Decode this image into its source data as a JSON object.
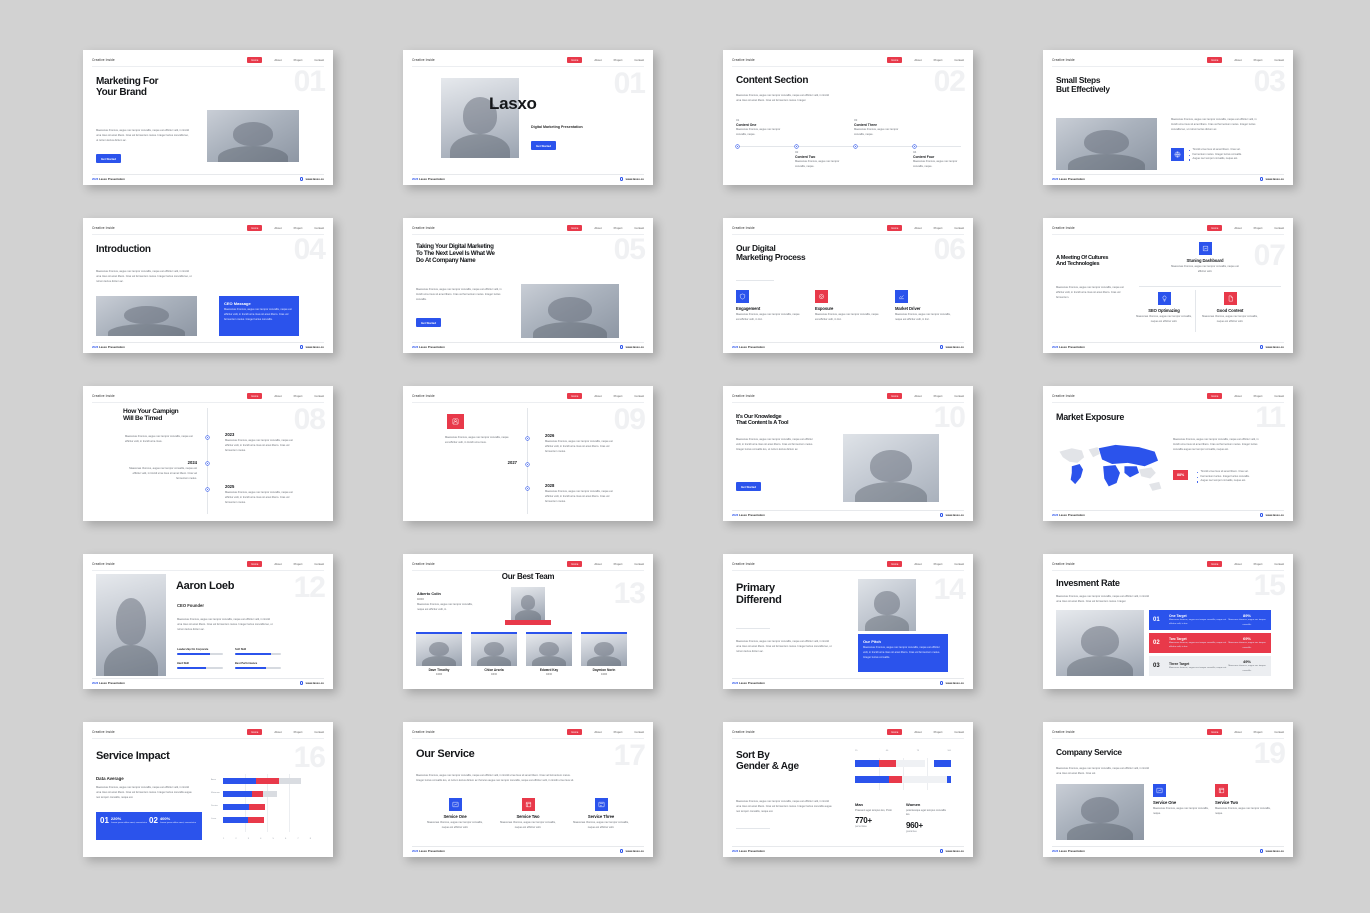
{
  "meta": {
    "brand": "Creative Inside",
    "nav": [
      "Home",
      "About",
      "Project",
      "Contact"
    ],
    "footer_left_year": "2023",
    "footer_left_text": " Lasxo Presentation",
    "footer_right": "www.lasxo.co",
    "accent_blue": "#2b53ec",
    "accent_red": "#e8394a",
    "number_grey": "#f0f1f3",
    "lorem_short": "Maecenas rhoncus, augue nec tempor convallis, neque est efficitur velit.",
    "lorem_mid": "Maecenas rhoncus, augue nec tempor convallis, neque est efficitur velit, in tincidi urna risus sit amet libero. Cras vel fermentum metus. Integer luctus convallis leo, ut rutrum lectus dictum ac.",
    "lorem_tiny": "Maecenas rhoncus, augue nec tempor convallis, neque est efficitur velit, in tincid."
  },
  "slides": [
    {
      "number": "01",
      "title": "Marketing For\nYour Brand",
      "body": "Maecenas rhoncus, augue nec tempor convallis, neque est efficitur velit, in tincidi urna risus sit amet libero. Cras vel fermentum metus. Integer luctus convallis leo, ut rutrum lectus dictum ac.",
      "cta": "Get Started"
    },
    {
      "number": "01",
      "title": "Lasxo",
      "subtitle": "Digital Marketing Presentation",
      "cta": "Get Started"
    },
    {
      "number": "02",
      "title": "Content Section",
      "body": "Maecenas rhoncus, augue nec tempor convallis, neque est efficitur velit, in tincidi urna risus sit amet libero. Cras vel fermentum metus. Integer.",
      "items": [
        {
          "num": "01",
          "label": "Content One",
          "body": "Maecenas rhoncus, augue nec tempor convallis, neque."
        },
        {
          "num": "02",
          "label": "Content Two",
          "body": "Maecenas rhoncus, augue nec tempor convallis, neque."
        },
        {
          "num": "03",
          "label": "Content Three",
          "body": "Maecenas rhoncus, augue nec tempor convallis, neque."
        },
        {
          "num": "04",
          "label": "Content Four",
          "body": "Maecenas rhoncus, augue nec tempor convallis, neque."
        }
      ]
    },
    {
      "number": "03",
      "title": "Small Steps\nBut Effectively",
      "body": "Maecenas rhoncus, augue nec tempor convallis, neque est efficitur velit, in tincidi urna risus sit amet libero. Cras vel fermentum metus. Integer luctus convallis leo, ut rutrum lectus dictum ac.",
      "bullets": [
        "Tincidi urna risus sit amet libero. Cras vel.",
        "Fermentum metus. Integer luctus convallis.",
        "Augue nec tempor convallis, neque est."
      ],
      "icon": "globe-icon"
    },
    {
      "number": "04",
      "title": "Introduction",
      "body": "Maecenas rhoncus, augue nec tempor convallis, neque est efficitur velit, in tincidi urna risus sit amet libero. Cras vel fermentum metus. Integer luctus convallis leo, ut rutrum lectus dictum ac.",
      "card_title": "CEO Massage",
      "card_body": "Maecenas rhoncus, augue nec tempor convallis, neque est efficitur velit, in tincidi urna risus sit amet libero. Cras vel fermentum metus. Integer luctus convallis."
    },
    {
      "number": "05",
      "title": "Taking Your Digital Marketing\nTo The Next Level Is What We\nDo At Company Name",
      "body": "Maecenas rhoncus, augue nec tempor convallis, neque est efficitur velit, in tincidi urna risus sit amet libero. Cras vel fermentum metus. Integer luctus convallis.",
      "cta": "Get Started"
    },
    {
      "number": "06",
      "title": "Our Digital\nMarketing Process",
      "features": [
        {
          "label": "Engagement",
          "body": "Maecenas rhoncus, augue nec tempor convallis, neque est efficitur velit, in tinc.",
          "color": "blue",
          "icon": "shield-icon"
        },
        {
          "label": "Exposure",
          "body": "Maecenas rhoncus, augue nec tempor convallis, neque est efficitur velit, in tinc.",
          "color": "red",
          "icon": "target-icon"
        },
        {
          "label": "Market Driver",
          "body": "Maecenas rhoncus, augue nec tempor convallis, neque est efficitur velit, in tinc.",
          "color": "blue",
          "icon": "chart-icon"
        }
      ]
    },
    {
      "number": "07",
      "title": "A Meeting Of Cultures\nAnd Technologies",
      "body": "Maecenas rhoncus, augue nec tempor convallis, neque est efficitur velit, in tincidi urna risus sit amet libero. Cras vel fermentum.",
      "features": [
        {
          "label": "Stuning Dashboard",
          "body": "Maecenas rhoncus, augue nec tempor convallis, neque est efficitur velit.",
          "color": "blue",
          "icon": "dashboard-icon"
        },
        {
          "label": "SEO Optimazing",
          "body": "Maecenas rhoncus, augue nec tempor convallis, neque est efficitur velit.",
          "color": "blue",
          "icon": "bulb-icon"
        },
        {
          "label": "Good Content",
          "body": "Maecenas rhoncus, augue nec tempor convallis, neque est efficitur velit.",
          "color": "red",
          "icon": "doc-icon"
        }
      ]
    },
    {
      "number": "08",
      "title": "How Your Campign\nWill Be Timed",
      "events": [
        {
          "year": "2023",
          "body": "Maecenas rhoncus, augue nec tempor convallis, neque est efficitur velit, in tincidi urna risus sit amet libero. Cras vel fermentum metus.",
          "side": "right"
        },
        {
          "year": "2024",
          "body": "Maecenas rhoncus, augue nec tempor convallis, neque est efficitur velit, in tincidi urna risus sit amet libero. Cras vel fermentum metus.",
          "side": "left"
        },
        {
          "year": "2025",
          "body": "Maecenas rhoncus, augue nec tempor convallis, neque est efficitur velit, in tincidi urna risus sit amet libero. Cras vel fermentum metus.",
          "side": "right"
        }
      ],
      "lead": "Maecenas rhoncus, augue nec tempor convallis, neque est efficitur velit, in tincidi urna risus."
    },
    {
      "number": "09",
      "title": "",
      "icon": "user-icon",
      "lead": "Maecenas rhoncus, augue nec tempor convallis, neque est efficitur velit, in tincidi urna risus.",
      "events": [
        {
          "year": "2026",
          "body": "Maecenas rhoncus, augue nec tempor convallis, neque est efficitur velit, in tincidi urna risus sit amet libero. Cras vel fermentum metus.",
          "side": "right"
        },
        {
          "year": "2027",
          "body": "",
          "side": "left"
        },
        {
          "year": "2028",
          "body": "Maecenas rhoncus, augue nec tempor convallis, neque est efficitur velit, in tincidi urna risus sit amet libero. Cras vel fermentum metus.",
          "side": "right"
        }
      ]
    },
    {
      "number": "10",
      "title": "It's Our Knowledge\nThat Content Is A Tool",
      "body": "Maecenas rhoncus, augue nec tempor convallis, neque est efficitur velit, in tincidi urna risus sit amet libero. Cras vel fermentum metus. Integer luctus convallis leo, ut rutrum lectus dictum ac.",
      "cta": "Get Started"
    },
    {
      "number": "11",
      "title": "Market Exposure",
      "body": "Maecenas rhoncus, augue nec tempor convallis, neque est efficitur velit, in tincidi urna risus sit amet libero. Cras vel fermentum metus. Integer luctus convallis augue nec tempor convallis, neque est.",
      "badge": "88%",
      "bullets": [
        "Tincidi urna risus sit amet libero. Cras vel.",
        "Fermentum luctus. Integer luctus convallis.",
        "Augue nec tempor convallis, neque est."
      ]
    },
    {
      "number": "12",
      "name": "Aaron Loeb",
      "role": "CEO Founder",
      "body": "Maecenas rhoncus, augue nec tempor convallis, neque est efficitur velit, in tincidi urna risus sit amet libero. Cras vel fermentum metus. Integer luctus convallis leo, ut rutrum lectus dictum ac.",
      "skills": [
        {
          "label": "Leadership On Corporate",
          "value": 72
        },
        {
          "label": "Soft Skill",
          "value": 78
        },
        {
          "label": "Hard Skill",
          "value": 62
        },
        {
          "label": "Best Performance",
          "value": 68
        }
      ]
    },
    {
      "number": "13",
      "title": "Our Best Team",
      "lead_name": "Alberto Colin",
      "lead_role": "COO",
      "lead_body": "Maecenas rhoncus, augue nec tempor convallis, neque est efficitur velit, in.",
      "members": [
        {
          "name": "Dave Timothy",
          "role": "COO"
        },
        {
          "name": "Chloe Arsela",
          "role": "CFO"
        },
        {
          "name": "Edward Kay",
          "role": "CFO"
        },
        {
          "name": "Daymion Norin",
          "role": "COO"
        }
      ]
    },
    {
      "number": "14",
      "title": "Primary\nDifferend",
      "body": "Maecenas rhoncus, augue nec tempor convallis, neque est efficitur velit, in tincidi urna risus sit amet libero. Cras vel fermentum metus. Integer luctus convallis leo, ut rutrum lectus dictum ac.",
      "card_title": "Our Pitch",
      "card_body": "Maecenas rhoncus, augue nec tempor convallis, neque est efficitur velit, in tincidi urna risus sit amet libero. Cras vel fermentum metus. Integer luctus convallis."
    },
    {
      "number": "15",
      "title": "Invesment Rate",
      "body": "Maecenas rhoncus, augue nec tempor convallis, neque est efficitur velit, in tincidi urna risus sit amet libero. Cras vel fermentum metus. Integer.",
      "targets": [
        {
          "num": "01",
          "label": "One Target",
          "body": "Maecenas rhoncus, augue nec tempor convallis, neque est efficitur velit, in tinc.",
          "pct": "89%",
          "pct_body": "Maecenas rhoncus, augue nec tempor convallis.",
          "color": "blue"
        },
        {
          "num": "02",
          "label": "Two Target",
          "body": "Maecenas rhoncus, augue nec tempor convallis, neque est efficitur velit, in tinc.",
          "pct": "69%",
          "pct_body": "Maecenas rhoncus, augue nec tempor convallis.",
          "color": "red"
        },
        {
          "num": "03",
          "label": "Three Target",
          "body": "Maecenas rhoncus, augue nec tempor convallis, neque est.",
          "pct": "49%",
          "pct_body": "Maecenas rhoncus, augue nec tempor convallis.",
          "color": "grey"
        }
      ]
    },
    {
      "number": "16",
      "title": "Service Impact",
      "subtitle": "Data Average",
      "body": "Maecenas rhoncus, augue nec tempor convallis, neque est efficitur velit, in tincidi urna risus sit amet libero. Cras vel fermentum metus. Integer luctus convallis augue nec tempor convallis, neque est.",
      "stats": [
        {
          "num": "01",
          "value": "220%",
          "body": "Lorem ipsum dolor amet, consectetur"
        },
        {
          "num": "02",
          "value": "400%",
          "body": "Lorem ipsum dolor amet, consectetur"
        }
      ],
      "chart_data": {
        "type": "bar",
        "orientation": "horizontal",
        "title": "Data Average",
        "categories": [
          "Anax",
          "Minimum",
          "Desine",
          "Linse"
        ],
        "series": [
          {
            "name": "Series A",
            "color": "#2b53ec",
            "values": [
              3.0,
              2.6,
              2.3,
              2.2
            ]
          },
          {
            "name": "Series B",
            "color": "#e8394a",
            "values": [
              2.1,
              1.0,
              1.5,
              1.5
            ]
          },
          {
            "name": "Series C",
            "color": "#d9dce1",
            "values": [
              2.0,
              1.2,
              0.0,
              0.0
            ]
          }
        ],
        "xticks": [
          "1",
          "2",
          "3",
          "4",
          "5",
          "6",
          "7",
          "8"
        ],
        "xlim": [
          0,
          8
        ],
        "grid": true,
        "legend": "none"
      }
    },
    {
      "number": "17",
      "title": "Our Service",
      "body": "Maecenas rhoncus, augue nec tempor convallis, neque est efficitur velit, in tincidi urna risus sit amet libero. Cras vel fermentum metus. Integer luctus convallis leo, ut rutrum lectus dictum ac rhoncus augue nec tempor convallis, neque est efficitur velit, in tincidi urna risus sit.",
      "features": [
        {
          "label": "Service One",
          "body": "Maecenas rhoncus, augue nec tempor convallis, neque est efficitur velit.",
          "color": "blue",
          "icon": "chart-icon"
        },
        {
          "label": "Service Two",
          "body": "Maecenas rhoncus, augue nec tempor convallis, neque est efficitur velit.",
          "color": "red",
          "icon": "box-icon"
        },
        {
          "label": "Service Three",
          "body": "Maecenas rhoncus, augue nec tempor convallis, neque est efficitur velit.",
          "color": "blue",
          "icon": "cart-icon"
        }
      ]
    },
    {
      "number": "",
      "title": "Sort By\nGender & Age",
      "body": "Maecenas rhoncus, augue nec tempor convallis, neque est efficitur velit, in tincidi urna risus sit amet libero. Cras vel fermentum metus. Integer luctus convallis augue nec tempor convallis, neque est.",
      "groups": [
        {
          "label": "Man",
          "body": "Praesent eget tempus leo, Proin",
          "value": "770+",
          "caption": "persentase"
        },
        {
          "label": "Women",
          "body": "potentesque eget tempus convallis leo",
          "value": "960+",
          "caption": "guarantee"
        }
      ],
      "chart_data": {
        "type": "bar",
        "orientation": "horizontal",
        "title": "Sort By Gender & Age",
        "categories": [
          "Man",
          "Women"
        ],
        "xticks": [
          "25",
          "40",
          "73",
          "100"
        ],
        "series": [
          {
            "name": "Blue",
            "color": "#2b53ec",
            "values": [
              25,
              35
            ]
          },
          {
            "name": "Red",
            "color": "#e8394a",
            "values": [
              18,
              14
            ]
          },
          {
            "name": "Grey",
            "color": "#eceef1",
            "values": [
              30,
              45
            ]
          },
          {
            "name": "Blue End",
            "color": "#2b53ec",
            "values": [
              18,
              4
            ]
          }
        ],
        "xlim": [
          0,
          100
        ],
        "grid": true
      }
    },
    {
      "number": "19",
      "title": "Company Service",
      "body": "Maecenas rhoncus, augue nec tempor convallis, neque est efficitur velit, in tincidi urna risus sit amet libero. Cras vel.",
      "features": [
        {
          "label": "Service One",
          "body": "Maecenas rhoncus, augue nec tempor convallis, neque.",
          "color": "blue",
          "icon": "chart-icon"
        },
        {
          "label": "Service Two",
          "body": "Maecenas rhoncus, augue nec tempor convallis, neque.",
          "color": "red",
          "icon": "box-icon"
        }
      ]
    }
  ]
}
